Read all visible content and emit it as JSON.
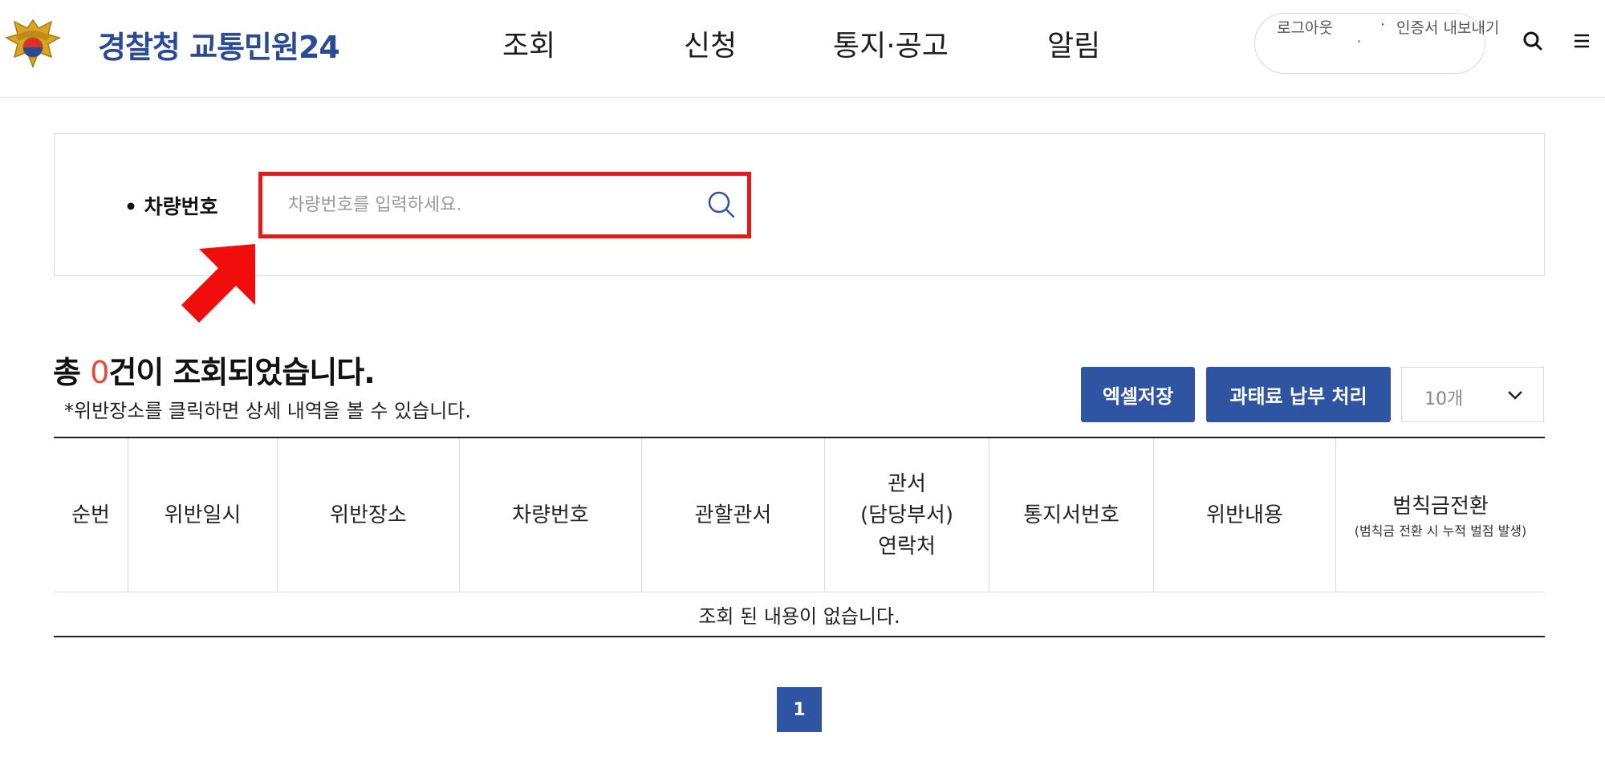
{
  "header": {
    "logo_text": "경찰청 교통민원24",
    "nav": [
      "조회",
      "신청",
      "통지·공고",
      "알림"
    ],
    "auth": {
      "logout": "로그아웃",
      "separator": "·",
      "export_cert": "인증서 내보내기"
    }
  },
  "search": {
    "label": "• 차량번호",
    "placeholder": "차량번호를 입력하세요.",
    "value": ""
  },
  "results": {
    "prefix": "총 ",
    "count": "0",
    "suffix": "건이 조회되었습니다.",
    "note": "*위반장소를 클릭하면 상세 내역을 볼 수 있습니다."
  },
  "actions": {
    "excel_label": "엑셀저장",
    "pay_label": "과태료 납부 처리",
    "page_size": "10개"
  },
  "table": {
    "columns": [
      {
        "label": "순번"
      },
      {
        "label": "위반일시"
      },
      {
        "label": "위반장소"
      },
      {
        "label": "차량번호"
      },
      {
        "label": "관할관서"
      },
      {
        "label": "관서",
        "line2": "(담당부서)",
        "line3": "연락처"
      },
      {
        "label": "통지서번호"
      },
      {
        "label": "위반내용"
      },
      {
        "label": "범칙금전환",
        "sub": "(범칙금 전환 시 누적 벌점 발생)"
      }
    ],
    "empty_message": "조회 된 내용이 없습니다."
  },
  "pagination": {
    "current": "1"
  },
  "colors": {
    "brand_blue": "#2f54a1",
    "highlight_red": "#e31b1b",
    "count_red": "#e34c3b",
    "logo_text": "#2a4a96"
  }
}
